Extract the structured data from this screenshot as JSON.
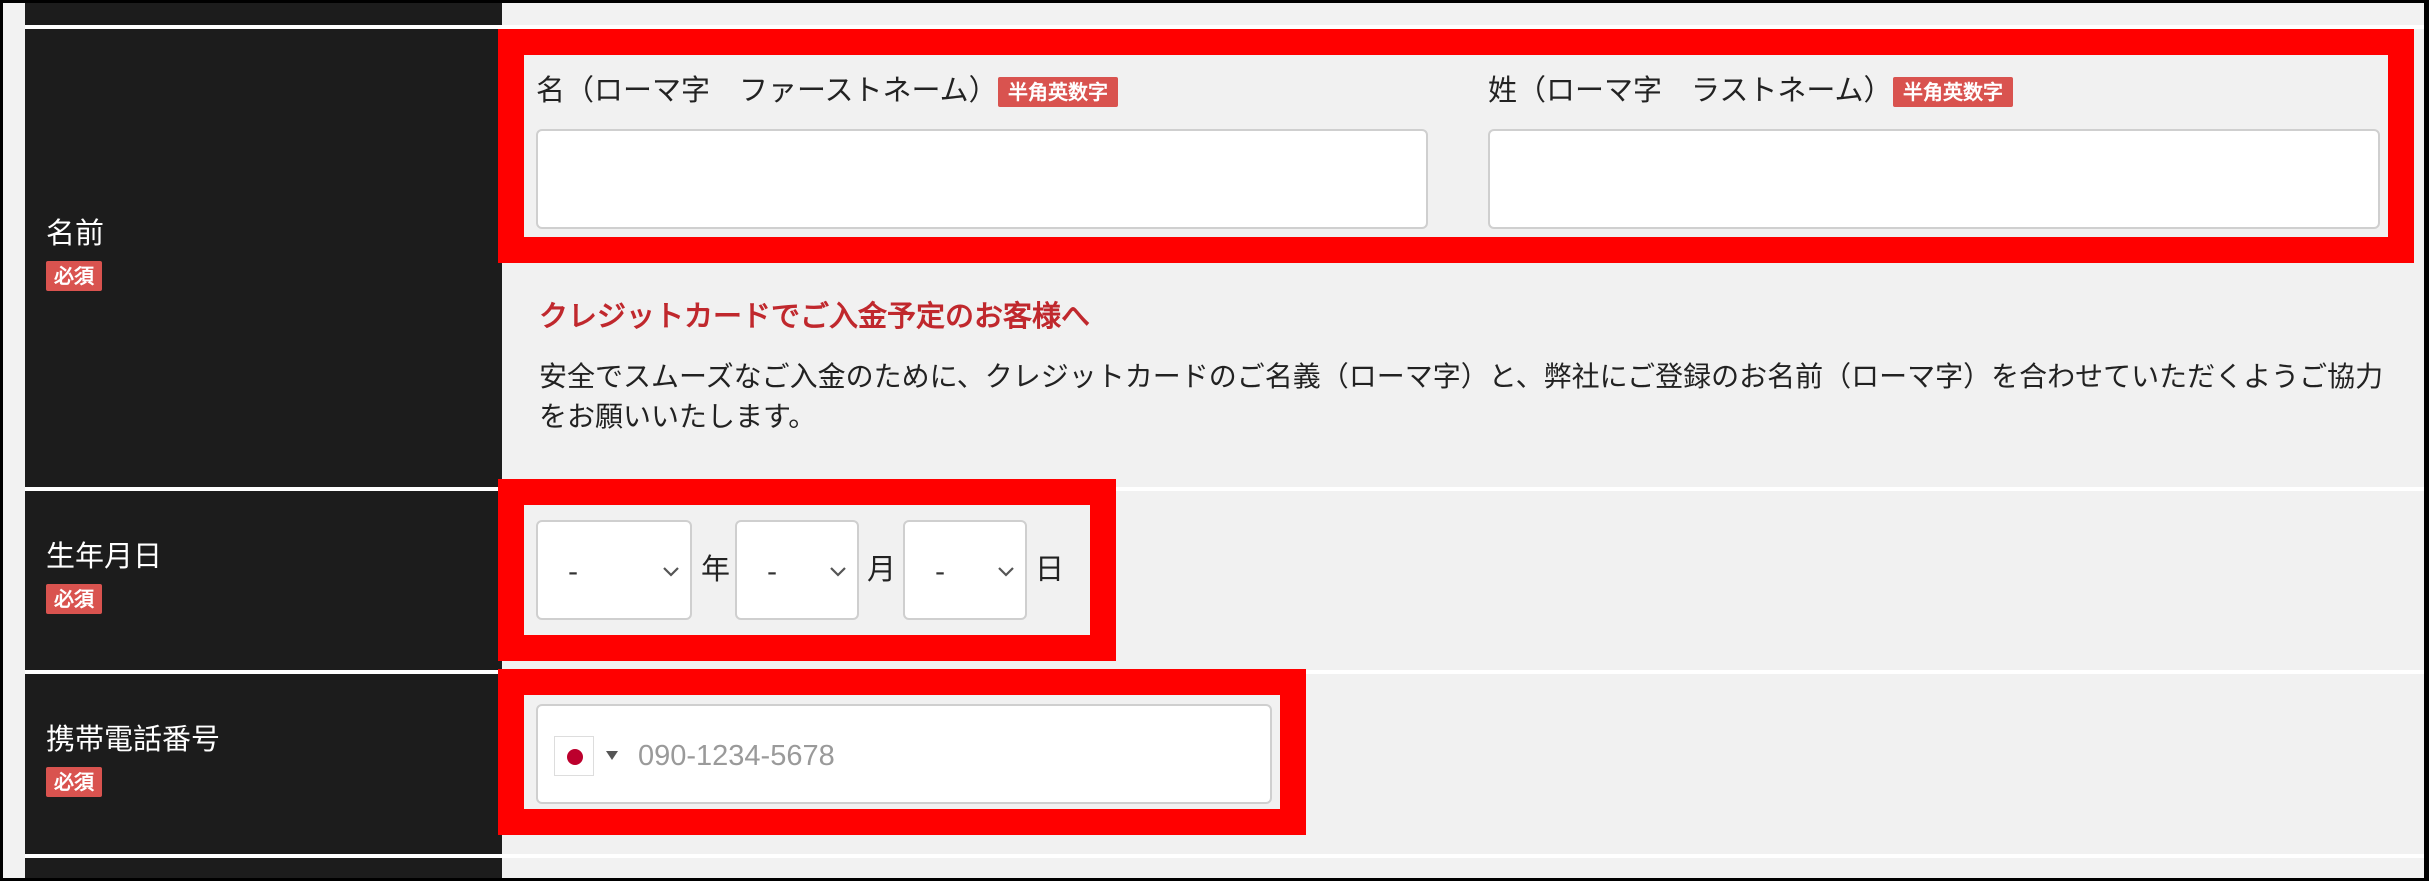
{
  "required_badge": "必須",
  "name_row": {
    "label": "名前",
    "first_name_label": "名（ローマ字　ファーストネーム）",
    "last_name_label": "姓（ローマ字　ラストネーム）",
    "alnum_badge": "半角英数字",
    "first_name_value": "",
    "last_name_value": ""
  },
  "notice": {
    "title": "クレジットカードでご入金予定のお客様へ",
    "body": "安全でスムーズなご入金のために、クレジットカードのご名義（ローマ字）と、弊社にご登録のお名前（ローマ字）を合わせていただくようご協力をお願いいたします。"
  },
  "birthday_row": {
    "label": "生年月日",
    "year_value": "-",
    "month_value": "-",
    "day_value": "-",
    "year_unit": "年",
    "month_unit": "月",
    "day_unit": "日"
  },
  "phone_row": {
    "label": "携帯電話番号",
    "country_flag": "japan-flag-icon",
    "placeholder": "090-1234-5678",
    "value": ""
  },
  "colors": {
    "header_bg": "#1c1c1c",
    "highlight": "#ff0000",
    "badge": "#d9534f",
    "notice_title": "#c0282d"
  }
}
